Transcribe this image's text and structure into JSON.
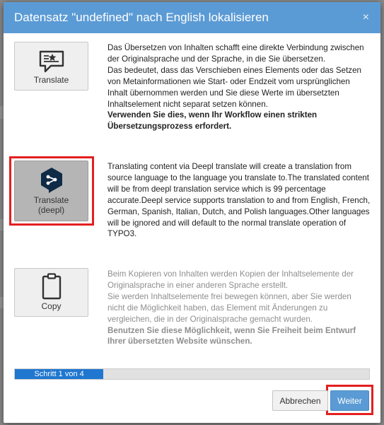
{
  "dialog": {
    "title": "Datensatz \"undefined\" nach English lokalisieren",
    "close_symbol": "×"
  },
  "options": [
    {
      "label": "Translate",
      "icon": "translate-icon",
      "desc": [
        "Das Übersetzen von Inhalten schafft eine direkte Verbindung zwischen der Originalsprache und der Sprache, in die Sie übersetzen.",
        "Das bedeutet, dass das Verschieben eines Elements oder das Setzen von Metainformationen wie Start- oder Endzeit vom ursprünglichen Inhalt übernommen werden und Sie diese Werte im übersetzten Inhaltselement nicht separat setzen können."
      ],
      "desc_strong": "Verwenden Sie dies, wenn Ihr Workflow einen strikten Übersetzungsprozess erfordert."
    },
    {
      "label_line1": "Translate",
      "label_line2": "(deepl)",
      "icon": "deepl-icon",
      "desc": "Translating content via Deepl translate will create a translation from source language to the language you translate to.The translated content will be from deepl translation service which is 99 percentage accurate.Deepl service supports translation to and from English, French, German, Spanish, Italian, Dutch, and Polish languages.Other languages will be ignored and will default to the normal translate operation of TYPO3."
    },
    {
      "label": "Copy",
      "icon": "clipboard-icon",
      "desc": [
        "Beim Kopieren von Inhalten werden Kopien der Inhaltselemente der Originalsprache in einer anderen Sprache erstellt.",
        "Sie werden Inhaltselemente frei bewegen können, aber Sie werden nicht die Möglichkeit haben, das Element mit Änderungen zu vergleichen, die in der Originalsprache gemacht wurden."
      ],
      "desc_strong": "Benutzen Sie diese Möglichkeit, wenn Sie Freiheit beim Entwurf Ihrer übersetzten Website wünschen."
    }
  ],
  "progress": {
    "label": "Schritt 1 von 4",
    "fraction": 0.25
  },
  "footer": {
    "back_label": "Abbrechen",
    "next_label": "Weiter"
  },
  "colors": {
    "header": "#5b9bd5",
    "progress": "#1f77d0",
    "highlight": "#e41f1f"
  }
}
